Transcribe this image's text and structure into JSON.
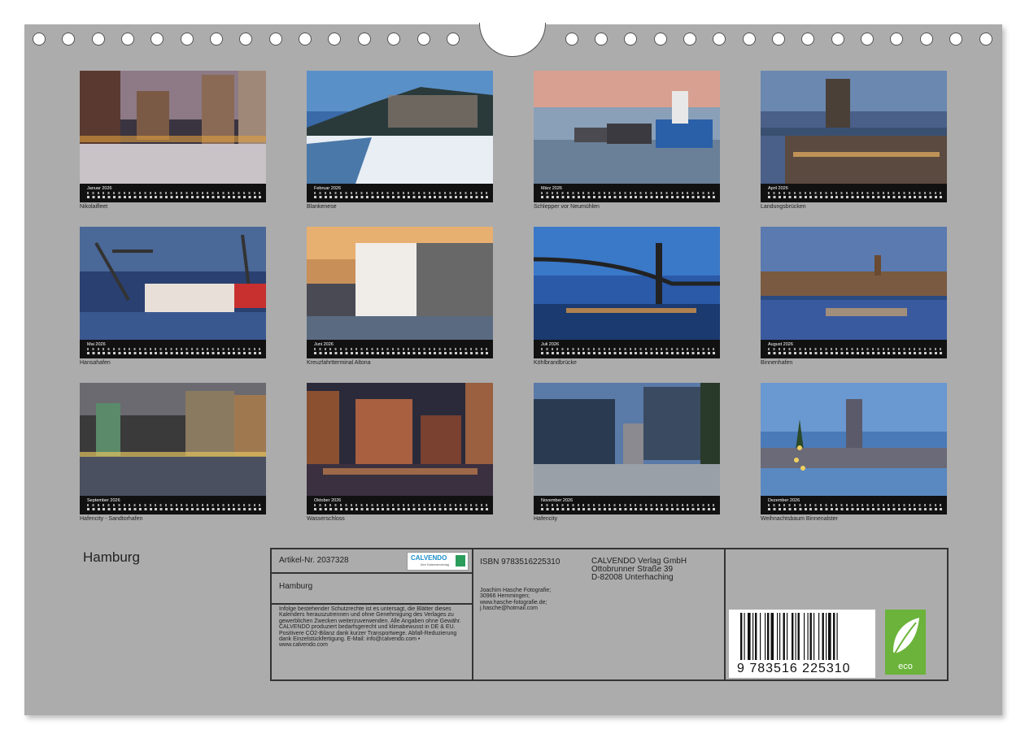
{
  "months": [
    {
      "month": "Januar",
      "year": "2026",
      "caption": "Nikolaifleet"
    },
    {
      "month": "Februar",
      "year": "2026",
      "caption": "Blankenese"
    },
    {
      "month": "März",
      "year": "2026",
      "caption": "Schlepper vor Neumühlen"
    },
    {
      "month": "April",
      "year": "2026",
      "caption": "Landungsbrücken"
    },
    {
      "month": "Mai",
      "year": "2026",
      "caption": "Hansahafen"
    },
    {
      "month": "Juni",
      "year": "2026",
      "caption": "Kreuzfahrtterminal Altona"
    },
    {
      "month": "Juli",
      "year": "2026",
      "caption": "Köhlbrandbrücke"
    },
    {
      "month": "August",
      "year": "2026",
      "caption": "Binnenhafen"
    },
    {
      "month": "September",
      "year": "2026",
      "caption": "Hafencity - Sandtorhafen"
    },
    {
      "month": "Oktober",
      "year": "2026",
      "caption": "Wasserschloss"
    },
    {
      "month": "November",
      "year": "2026",
      "caption": "Hafencity"
    },
    {
      "month": "Dezember",
      "year": "2026",
      "caption": "Weihnachtsbaum Binnenalster"
    }
  ],
  "calendar_title": "Hamburg",
  "info": {
    "artikel": "Artikel-Nr. 2037328",
    "logo_text": "CALVENDO",
    "logo_sub": "Ihre Kalenderverlag",
    "title": "Hamburg",
    "legal": "Infolge bestehender Schutzrechte ist es untersagt, die Blätter dieses Kalenders herauszutrennen und ohne Genehmigung des Verlages zu gewerblichen Zwecken weiterzuverwenden. Alle Angaben ohne Gewähr. CALVENDO produziert bedarfsgerecht und klimabewusst in DE & EU. Positivere CO2-Bilanz dank kurzer Transportwege. Abfall-Reduzierung dank Einzelstückfertigung. E-Mail: info@calvendo.com • www.calvendo.com",
    "isbn": "ISBN 9783516225310",
    "author_lines": [
      "Joachim Hasche Fotografie;",
      "30966 Hemmingen;",
      "www.hasche-fotografie.de;",
      "j.hasche@hotmail.com"
    ],
    "publisher_lines": [
      "CALVENDO Verlag GmbH",
      "Ottobrunner Straße 39",
      "D-82008 Unterhaching"
    ],
    "barcode_number": "9 783516 225310",
    "eco_label": "eco"
  }
}
